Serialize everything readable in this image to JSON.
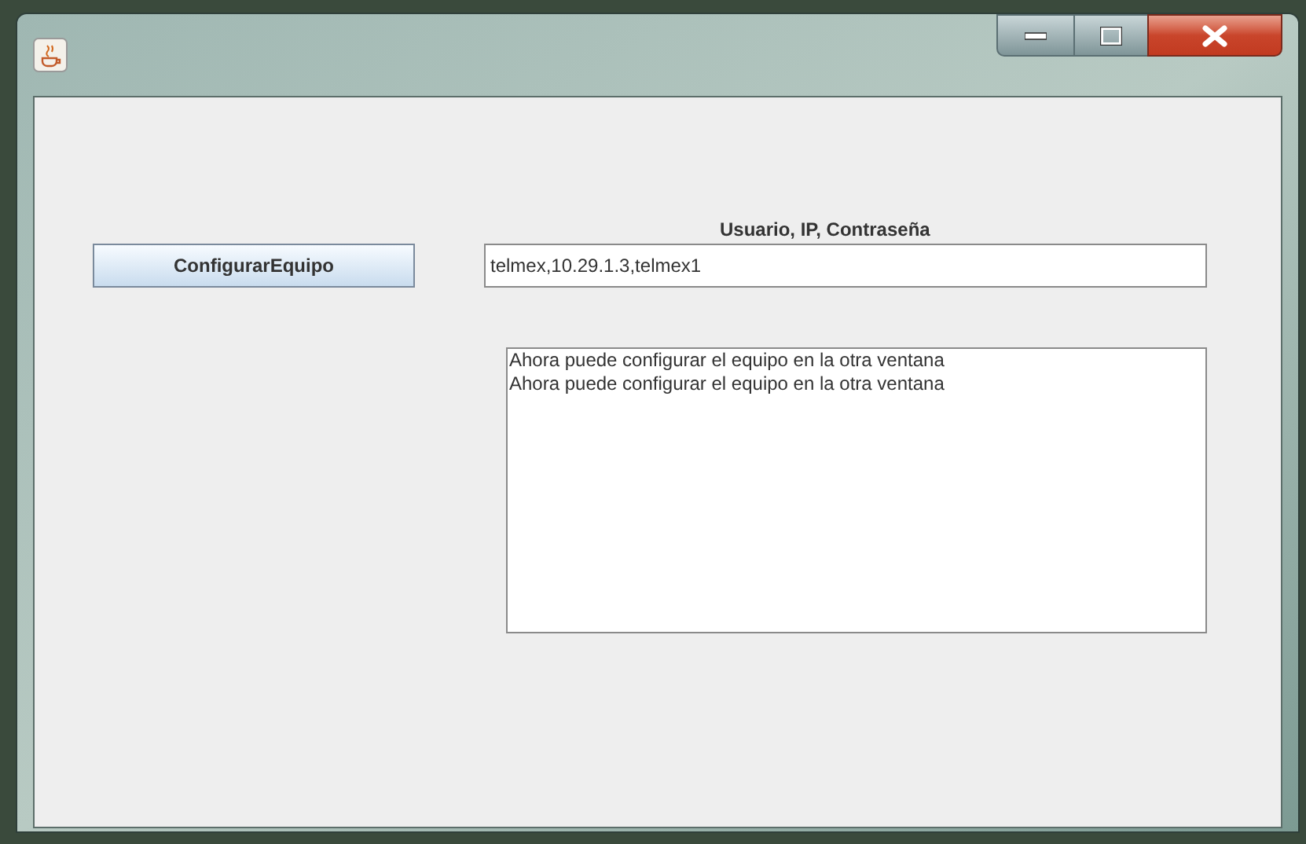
{
  "window": {
    "controls": [
      {
        "kind": "minimize"
      },
      {
        "kind": "maximize"
      },
      {
        "kind": "close"
      }
    ]
  },
  "label": "Usuario, IP, Contraseña",
  "button": {
    "label": "ConfigurarEquipo"
  },
  "input": {
    "value": "telmex,10.29.1.3,telmex1"
  },
  "output": {
    "lines": [
      "Ahora puede configurar el equipo en la otra ventana",
      "Ahora puede configurar el equipo en la otra ventana"
    ]
  }
}
